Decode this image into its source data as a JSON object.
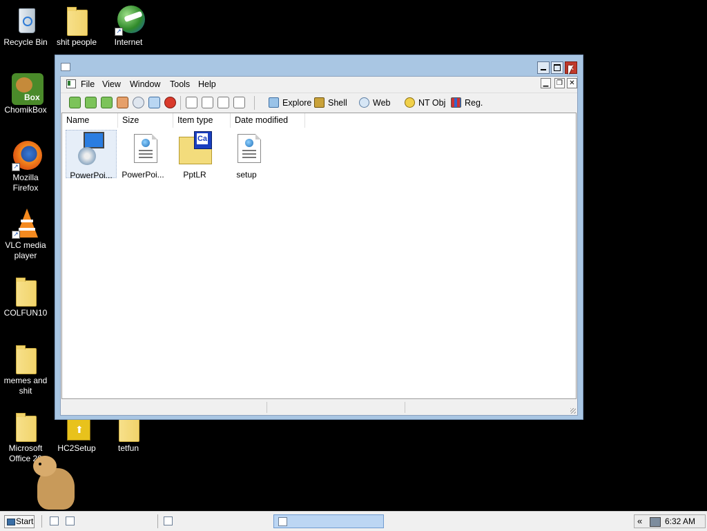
{
  "desktop": {
    "icons": [
      {
        "label": "Recycle Bin",
        "icon": "recycle-bin-icon"
      },
      {
        "label": "shit people",
        "icon": "folder-icon"
      },
      {
        "label": "Internet",
        "icon": "internet-download-manager-icon"
      },
      {
        "label": "ChomikBox",
        "icon": "chomikbox-icon",
        "badge": "Box"
      },
      {
        "label": "Mozilla Firefox",
        "icon": "firefox-icon"
      },
      {
        "label": "VLC media player",
        "icon": "vlc-icon"
      },
      {
        "label": "COLFUN10",
        "icon": "folder-icon"
      },
      {
        "label": "memes and shit",
        "icon": "folder-icon"
      },
      {
        "label": "Microsoft Office 20",
        "icon": "folder-icon"
      },
      {
        "label": "HC2Setup",
        "icon": "installer-icon"
      },
      {
        "label": "tetfun",
        "icon": "folder-icon"
      }
    ]
  },
  "window": {
    "menu": [
      "File",
      "View",
      "Window",
      "Tools",
      "Help"
    ],
    "toolbar": {
      "buttons": [
        "back",
        "forward",
        "up",
        "home",
        "search",
        "refresh",
        "stop",
        "large-icons",
        "small-icons",
        "list",
        "details"
      ],
      "labeled": [
        "Explore",
        "Shell",
        "Web",
        "NT Obj",
        "Reg."
      ]
    },
    "columns": [
      "Name",
      "Size",
      "Item type",
      "Date modified"
    ],
    "items": [
      {
        "label": "PowerPoi...",
        "icon": "setup-installer-icon",
        "selected": true
      },
      {
        "label": "PowerPoi...",
        "icon": "document-globe-icon",
        "selected": false
      },
      {
        "label": "PptLR",
        "icon": "folder-cab-icon",
        "badge": "Ca",
        "selected": false
      },
      {
        "label": "setup",
        "icon": "document-globe-icon",
        "selected": false
      }
    ]
  },
  "taskbar": {
    "start_label": "Start",
    "clock": "6:32 AM",
    "tray_chevron": "«"
  }
}
